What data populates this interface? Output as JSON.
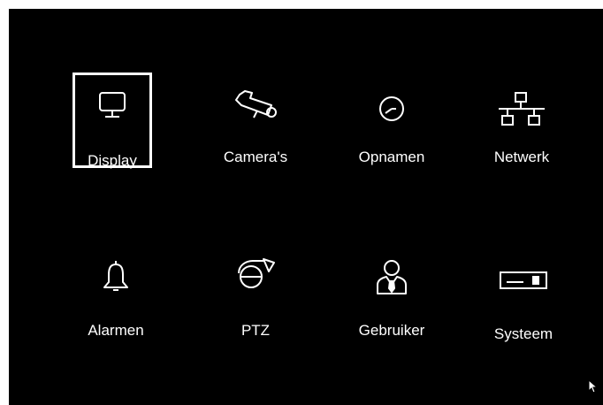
{
  "menu": {
    "selected_item": "Display",
    "items": [
      {
        "label": "Display",
        "icon": "monitor-icon"
      },
      {
        "label": "Camera's",
        "icon": "camera-icon"
      },
      {
        "label": "Opnamen",
        "icon": "clock-icon"
      },
      {
        "label": "Netwerk",
        "icon": "network-icon"
      },
      {
        "label": "Alarmen",
        "icon": "bell-icon"
      },
      {
        "label": "PTZ",
        "icon": "ptz-camera-icon"
      },
      {
        "label": "Gebruiker",
        "icon": "user-icon"
      },
      {
        "label": "Systeem",
        "icon": "dvr-device-icon"
      }
    ]
  },
  "colors": {
    "background": "#000000",
    "foreground": "#ffffff",
    "selection_border": "#ffffff"
  }
}
